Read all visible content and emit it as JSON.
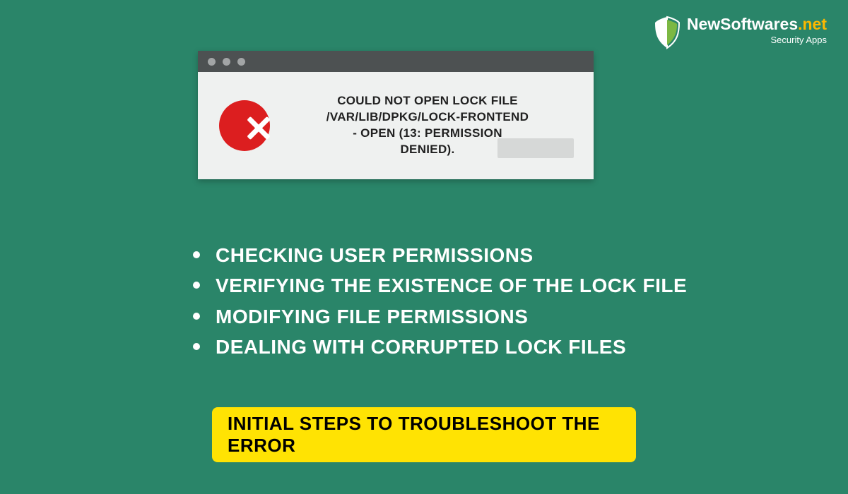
{
  "logo": {
    "brand_first": "NewSoftwares",
    "brand_accent": ".net",
    "subtitle": "Security Apps"
  },
  "dialog": {
    "error_line1": "COULD NOT OPEN LOCK FILE",
    "error_line2": "/VAR/LIB/DPKG/LOCK-FRONTEND",
    "error_line3": "- OPEN (13: PERMISSION",
    "error_line4": "DENIED)."
  },
  "steps": [
    "CHECKING USER PERMISSIONS",
    "VERIFYING THE EXISTENCE OF THE LOCK FILE",
    "MODIFYING FILE PERMISSIONS",
    "DEALING WITH CORRUPTED LOCK FILES"
  ],
  "footer": {
    "label": "INITIAL STEPS TO TROUBLESHOOT THE ERROR"
  }
}
